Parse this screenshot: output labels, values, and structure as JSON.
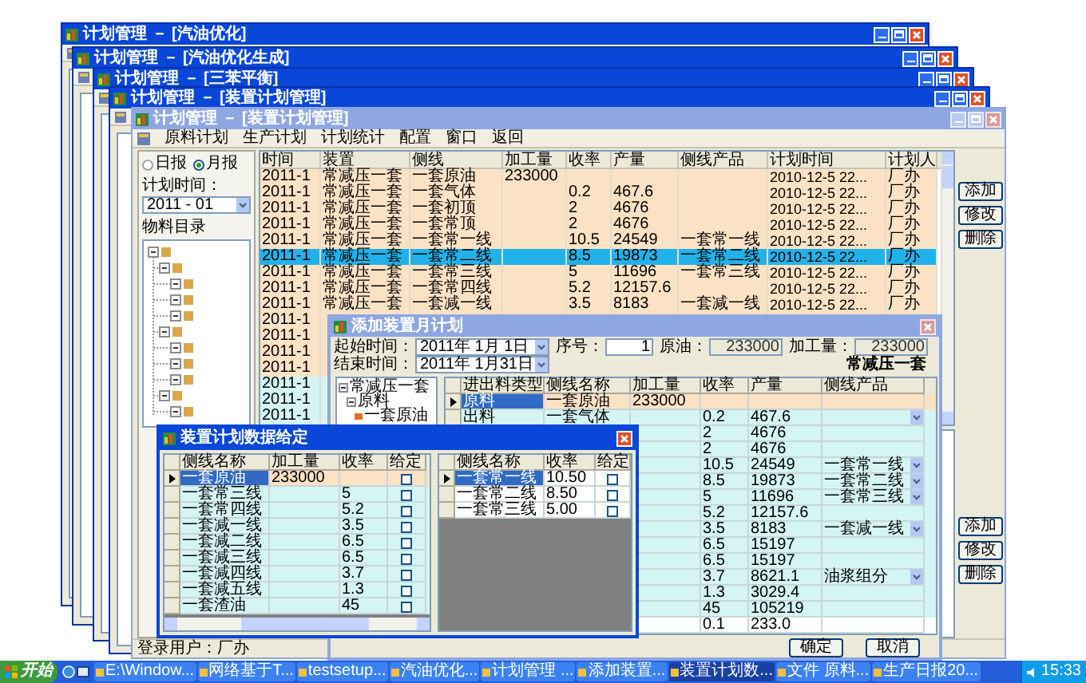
{
  "background_windows": [
    {
      "title": "计划管理 － [汽油优化]",
      "active": true
    },
    {
      "title": "计划管理 － [汽油优化生成]",
      "active": true
    },
    {
      "title": "计划管理 － [三苯平衡]",
      "active": true
    },
    {
      "title": "计划管理 － [装置计划管理]",
      "active": true
    }
  ],
  "main_window": {
    "title": "计划管理 － [装置计划管理]",
    "active": false,
    "menu": [
      "原料计划",
      "生产计划",
      "计划统计",
      "配置",
      "窗口",
      "返回"
    ],
    "report_type": [
      {
        "label": "日报",
        "selected": false
      },
      {
        "label": "月报",
        "selected": true
      }
    ],
    "plan_time": {
      "label": "计划时间：",
      "value": "2011 - 01"
    },
    "tree_title": "物料目录",
    "table": {
      "columns": [
        "时间",
        "装置",
        "侧线",
        "加工量",
        "收率",
        "产量",
        "侧线产品",
        "计划时间",
        "计划人"
      ],
      "rows": [
        {
          "cells": [
            "2011-1",
            "常减压一套",
            "一套原油",
            "233000",
            null,
            null,
            null,
            "2010-12-5 22...",
            "厂办"
          ],
          "selected": false,
          "color": "#fbe2c5"
        },
        {
          "cells": [
            "2011-1",
            "常减压一套",
            "一套气体",
            null,
            "0.2",
            "467.6",
            null,
            "2010-12-5 22...",
            "厂办"
          ],
          "selected": false,
          "color": "#fbe2c5"
        },
        {
          "cells": [
            "2011-1",
            "常减压一套",
            "一套初顶",
            null,
            "2",
            "4676",
            null,
            "2010-12-5 22...",
            "厂办"
          ],
          "selected": false,
          "color": "#fbe2c5"
        },
        {
          "cells": [
            "2011-1",
            "常减压一套",
            "一套常顶",
            null,
            "2",
            "4676",
            null,
            "2010-12-5 22...",
            "厂办"
          ],
          "selected": false,
          "color": "#fbe2c5"
        },
        {
          "cells": [
            "2011-1",
            "常减压一套",
            "一套常一线",
            null,
            "10.5",
            "24549",
            "一套常一线",
            "2010-12-5 22...",
            "厂办"
          ],
          "selected": false,
          "color": "#fbe2c5"
        },
        {
          "cells": [
            "2011-1",
            "常减压一套",
            "一套常二线",
            null,
            "8.5",
            "19873",
            "一套常二线",
            "2010-12-5 22...",
            "厂办"
          ],
          "selected": true
        },
        {
          "cells": [
            "2011-1",
            "常减压一套",
            "一套常三线",
            null,
            "5",
            "11696",
            "一套常三线",
            "2010-12-5 22...",
            "厂办"
          ],
          "selected": false,
          "color": "#fbe2c5"
        },
        {
          "cells": [
            "2011-1",
            "常减压一套",
            "一套常四线",
            null,
            "5.2",
            "12157.6",
            null,
            "2010-12-5 22...",
            "厂办"
          ],
          "selected": false,
          "color": "#fbe2c5"
        },
        {
          "cells": [
            "2011-1",
            "常减压一套",
            "一套减一线",
            null,
            "3.5",
            "8183",
            "一套减一线",
            "2010-12-5 22...",
            "厂办"
          ],
          "selected": false,
          "color": "#fbe2c5"
        },
        {
          "cells": [
            "2011-1",
            null,
            null,
            null,
            null,
            null,
            null,
            null,
            null
          ],
          "selected": false,
          "color": "#fbe2c5"
        },
        {
          "cells": [
            "2011-1",
            null,
            null,
            null,
            null,
            null,
            null,
            null,
            null
          ],
          "selected": false,
          "color": "#fbe2c5"
        },
        {
          "cells": [
            "2011-1",
            null,
            null,
            null,
            null,
            null,
            null,
            null,
            null
          ],
          "selected": false,
          "color": "#fbe2c5"
        },
        {
          "cells": [
            "2011-1",
            null,
            null,
            null,
            null,
            null,
            null,
            null,
            null
          ],
          "selected": false,
          "color": "#fbe2c5"
        },
        {
          "cells": [
            "2011-1",
            null,
            null,
            null,
            null,
            null,
            null,
            null,
            null
          ],
          "selected": false,
          "color": "#d5f4f4"
        },
        {
          "cells": [
            "2011-1",
            null,
            null,
            null,
            null,
            null,
            null,
            null,
            null
          ],
          "selected": false,
          "color": "#d5f4f4"
        },
        {
          "cells": [
            "2011-1",
            null,
            null,
            null,
            null,
            null,
            null,
            null,
            null
          ],
          "selected": false,
          "color": "#d5f4f4"
        }
      ]
    },
    "buttons": [
      "添加",
      "修改",
      "删除"
    ],
    "lower_buttons": [
      "添加",
      "修改",
      "删除"
    ],
    "status_bar": "登录用户：厂办"
  },
  "add_dialog": {
    "title": "添加装置月计划",
    "active": false,
    "start_label": "起始时间：",
    "start_date": "2011年 1月 1日",
    "end_label": "结束时间：",
    "end_date": "2011年 1月31日",
    "fields": [
      {
        "label": "序号：",
        "value": "1",
        "disabled": false
      },
      {
        "label": "原油：",
        "value": "233000",
        "disabled": true
      },
      {
        "label": "加工量：",
        "value": "233000",
        "disabled": true
      }
    ],
    "unit_heading": "常减压一套",
    "tree": [
      {
        "label": "常减压一套",
        "expanded": true,
        "children": [
          {
            "label": "原料",
            "expanded": true,
            "children": [
              {
                "label": "一套原油"
              }
            ]
          }
        ]
      }
    ],
    "grid": {
      "columns": [
        "进出料类型",
        "侧线名称",
        "加工量",
        "收率",
        "产量",
        "侧线产品"
      ],
      "rows": [
        {
          "cells": [
            "原料",
            "一套原油",
            "233000",
            null,
            null,
            null
          ],
          "selected": true,
          "combo": false,
          "color": "#fbe2c5"
        },
        {
          "cells": [
            "出料",
            "一套气体",
            null,
            "0.2",
            "467.6",
            null
          ],
          "selected": false,
          "combo": true,
          "color": "#d5f4f4"
        },
        {
          "cells": [
            null,
            null,
            null,
            "2",
            "4676",
            null
          ],
          "selected": false,
          "combo": false,
          "color": "#d5f4f4"
        },
        {
          "cells": [
            null,
            null,
            null,
            "2",
            "4676",
            null
          ],
          "selected": false,
          "combo": false,
          "color": "#d5f4f4"
        },
        {
          "cells": [
            null,
            null,
            null,
            "10.5",
            "24549",
            "一套常一线"
          ],
          "selected": false,
          "combo": true,
          "color": "#d5f4f4"
        },
        {
          "cells": [
            null,
            null,
            null,
            "8.5",
            "19873",
            "一套常二线"
          ],
          "selected": false,
          "combo": true,
          "color": "#d5f4f4"
        },
        {
          "cells": [
            null,
            null,
            null,
            "5",
            "11696",
            "一套常三线"
          ],
          "selected": false,
          "combo": true,
          "color": "#d5f4f4"
        },
        {
          "cells": [
            null,
            null,
            null,
            "5.2",
            "12157.6",
            null
          ],
          "selected": false,
          "combo": false,
          "color": "#d5f4f4"
        },
        {
          "cells": [
            null,
            null,
            null,
            "3.5",
            "8183",
            "一套减一线"
          ],
          "selected": false,
          "combo": true,
          "color": "#d5f4f4"
        },
        {
          "cells": [
            null,
            null,
            null,
            "6.5",
            "15197",
            null
          ],
          "selected": false,
          "combo": false,
          "color": "#d5f4f4"
        },
        {
          "cells": [
            null,
            null,
            null,
            "6.5",
            "15197",
            null
          ],
          "selected": false,
          "combo": false,
          "color": "#d5f4f4"
        },
        {
          "cells": [
            null,
            null,
            null,
            "3.7",
            "8621.1",
            "油浆组分"
          ],
          "selected": false,
          "combo": true,
          "color": "#d5f4f4"
        },
        {
          "cells": [
            null,
            null,
            null,
            "1.3",
            "3029.4",
            null
          ],
          "selected": false,
          "combo": false,
          "color": "#d5f4f4"
        },
        {
          "cells": [
            null,
            null,
            null,
            "45",
            "105219",
            null
          ],
          "selected": false,
          "combo": false,
          "color": "#d5f4f4"
        },
        {
          "cells": [
            null,
            null,
            null,
            "0.1",
            "233.0",
            null
          ],
          "selected": false,
          "combo": false,
          "color": "#ffffff"
        }
      ]
    },
    "buttons": [
      "确定",
      "取消"
    ]
  },
  "data_dialog": {
    "title": "装置计划数据给定",
    "active": true,
    "left_grid": {
      "columns": [
        "侧线名称",
        "加工量",
        "收率",
        "给定"
      ],
      "rows": [
        {
          "cells": [
            "一套原油",
            "233000",
            null
          ],
          "checked": false,
          "selected": true,
          "color": "#fbe2c5"
        },
        {
          "cells": [
            "一套常三线",
            null,
            "5"
          ],
          "checked": false,
          "selected": false,
          "color": "#d5f4f4"
        },
        {
          "cells": [
            "一套常四线",
            null,
            "5.2"
          ],
          "checked": false,
          "selected": false,
          "color": "#d5f4f4"
        },
        {
          "cells": [
            "一套减一线",
            null,
            "3.5"
          ],
          "checked": false,
          "selected": false,
          "color": "#d5f4f4"
        },
        {
          "cells": [
            "一套减二线",
            null,
            "6.5"
          ],
          "checked": false,
          "selected": false,
          "color": "#d5f4f4"
        },
        {
          "cells": [
            "一套减三线",
            null,
            "6.5"
          ],
          "checked": false,
          "selected": false,
          "color": "#d5f4f4"
        },
        {
          "cells": [
            "一套减四线",
            null,
            "3.7"
          ],
          "checked": false,
          "selected": false,
          "color": "#d5f4f4"
        },
        {
          "cells": [
            "一套减五线",
            null,
            "1.3"
          ],
          "checked": false,
          "selected": false,
          "color": "#d5f4f4"
        },
        {
          "cells": [
            "一套渣油",
            null,
            "45"
          ],
          "checked": false,
          "selected": false,
          "color": "#d5f4f4"
        }
      ]
    },
    "right_grid": {
      "columns": [
        "侧线名称",
        "收率",
        "给定"
      ],
      "rows": [
        {
          "cells": [
            "一套常一线",
            "10.50"
          ],
          "checked": false,
          "selected": true,
          "color": "#ffffff"
        },
        {
          "cells": [
            "一套常二线",
            "8.50"
          ],
          "checked": false,
          "selected": false,
          "color": "#ffffff"
        },
        {
          "cells": [
            "一套常三线",
            "5.00"
          ],
          "checked": false,
          "selected": false,
          "color": "#ffffff"
        }
      ]
    }
  },
  "taskbar": {
    "start": "开始",
    "items": [
      {
        "label": "E:\\Window...",
        "selected": false
      },
      {
        "label": "网络基于T...",
        "selected": false
      },
      {
        "label": "testsetup...",
        "selected": false
      },
      {
        "label": "汽油优化...",
        "selected": false
      },
      {
        "label": "计划管理 ...",
        "selected": false
      },
      {
        "label": "添加装置...",
        "selected": false
      },
      {
        "label": "装置计划数...",
        "selected": true
      },
      {
        "label": "文件 原料...",
        "selected": false
      },
      {
        "label": "生产日报20...",
        "selected": false
      }
    ],
    "clock": "15:33"
  }
}
